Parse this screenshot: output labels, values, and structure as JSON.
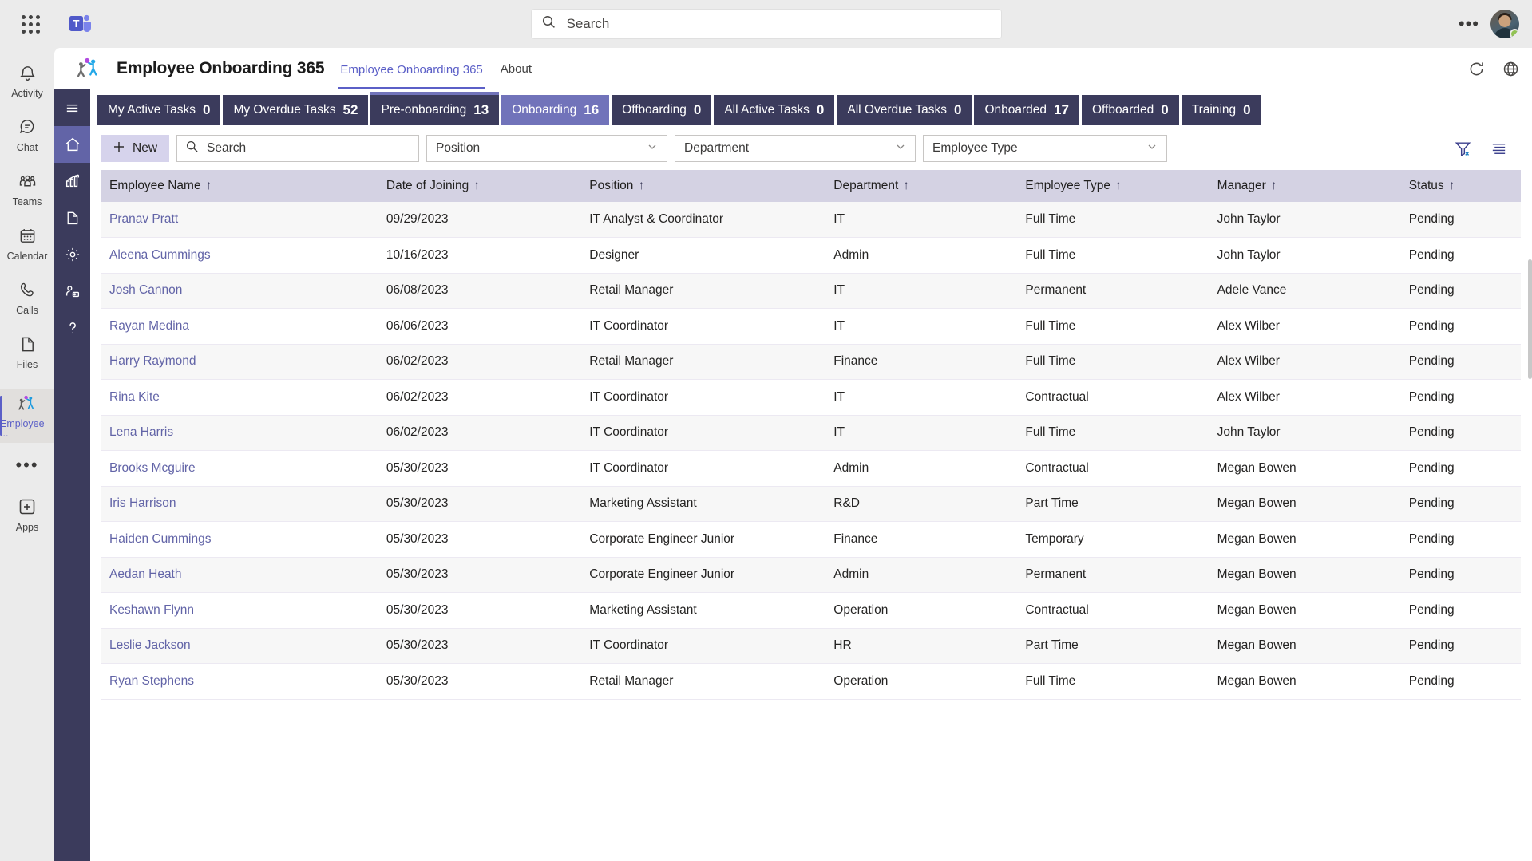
{
  "topbar": {
    "waffle_icon": "app-launcher-icon",
    "teams_logo": "microsoft-teams-logo",
    "search_placeholder": "Search",
    "search_value": "",
    "more_label": "•••"
  },
  "rail": {
    "items": [
      {
        "label": "Activity",
        "icon": "bell-icon",
        "active": false
      },
      {
        "label": "Chat",
        "icon": "chat-bubble-icon",
        "active": false
      },
      {
        "label": "Teams",
        "icon": "people-icon",
        "active": false
      },
      {
        "label": "Calendar",
        "icon": "calendar-icon",
        "active": false
      },
      {
        "label": "Calls",
        "icon": "phone-icon",
        "active": false
      },
      {
        "label": "Files",
        "icon": "document-icon",
        "active": false
      },
      {
        "label": "Employee ...",
        "icon": "employee-onboarding-icon",
        "active": true
      }
    ],
    "more_label": "•••",
    "apps_label": "Apps",
    "apps_icon": "apps-plus-icon"
  },
  "app_header": {
    "icon": "employee-onboarding-icon",
    "title": "Employee Onboarding 365",
    "tabs": [
      {
        "label": "Employee Onboarding 365",
        "selected": true
      },
      {
        "label": "About",
        "selected": false
      }
    ],
    "refresh_icon": "refresh-icon",
    "globe_icon": "globe-icon"
  },
  "innernav": {
    "items": [
      {
        "icon": "hamburger-menu-icon",
        "name": "menu-toggle",
        "active": false
      },
      {
        "icon": "home-icon",
        "name": "nav-home",
        "active": true
      },
      {
        "icon": "chart-icon",
        "name": "nav-reports",
        "active": false
      },
      {
        "icon": "document-icon",
        "name": "nav-documents",
        "active": false
      },
      {
        "icon": "gear-icon",
        "name": "nav-settings",
        "active": false
      },
      {
        "icon": "user-settings-icon",
        "name": "nav-users",
        "active": false
      },
      {
        "icon": "question-icon",
        "name": "nav-help",
        "active": false
      }
    ]
  },
  "tabstrip": {
    "tabs": [
      {
        "label": "My Active Tasks",
        "count": "0",
        "active": false
      },
      {
        "label": "My Overdue Tasks",
        "count": "52",
        "active": false
      },
      {
        "label": "Pre-onboarding",
        "count": "13",
        "active": false
      },
      {
        "label": "Onboarding",
        "count": "16",
        "active": true
      },
      {
        "label": "Offboarding",
        "count": "0",
        "active": false
      },
      {
        "label": "All Active Tasks",
        "count": "0",
        "active": false
      },
      {
        "label": "All Overdue Tasks",
        "count": "0",
        "active": false
      },
      {
        "label": "Onboarded",
        "count": "17",
        "active": false
      },
      {
        "label": "Offboarded",
        "count": "0",
        "active": false
      },
      {
        "label": "Training",
        "count": "0",
        "active": false
      }
    ]
  },
  "toolbar": {
    "new_label": "New",
    "new_icon": "plus-icon",
    "search_placeholder": "Search",
    "search_value": "",
    "search_icon": "search-icon",
    "filters": [
      {
        "name": "position-filter",
        "value": "Position"
      },
      {
        "name": "department-filter",
        "value": "Department"
      },
      {
        "name": "employee-type-filter",
        "value": "Employee Type"
      }
    ],
    "clear_filter_icon": "clear-filter-icon",
    "list-options_icon": "list-options-icon"
  },
  "table": {
    "sort_indicator": "↑",
    "columns": [
      "Employee Name",
      "Date of Joining",
      "Position",
      "Department",
      "Employee Type",
      "Manager",
      "Status"
    ],
    "rows": [
      {
        "name": "Pranav Pratt",
        "date": "09/29/2023",
        "position": "IT Analyst & Coordinator",
        "department": "IT",
        "type": "Full Time",
        "manager": "John Taylor",
        "status": "Pending"
      },
      {
        "name": "Aleena Cummings",
        "date": "10/16/2023",
        "position": "Designer",
        "department": "Admin",
        "type": "Full Time",
        "manager": "John Taylor",
        "status": "Pending"
      },
      {
        "name": "Josh Cannon",
        "date": "06/08/2023",
        "position": "Retail Manager",
        "department": "IT",
        "type": "Permanent",
        "manager": "Adele Vance",
        "status": "Pending"
      },
      {
        "name": "Rayan Medina",
        "date": "06/06/2023",
        "position": "IT Coordinator",
        "department": "IT",
        "type": "Full Time",
        "manager": "Alex Wilber",
        "status": "Pending"
      },
      {
        "name": "Harry Raymond",
        "date": "06/02/2023",
        "position": "Retail Manager",
        "department": "Finance",
        "type": "Full Time",
        "manager": "Alex Wilber",
        "status": "Pending"
      },
      {
        "name": "Rina Kite",
        "date": "06/02/2023",
        "position": "IT Coordinator",
        "department": "IT",
        "type": "Contractual",
        "manager": "Alex Wilber",
        "status": "Pending"
      },
      {
        "name": "Lena Harris",
        "date": "06/02/2023",
        "position": "IT Coordinator",
        "department": "IT",
        "type": "Full Time",
        "manager": "John Taylor",
        "status": "Pending"
      },
      {
        "name": "Brooks Mcguire",
        "date": "05/30/2023",
        "position": "IT Coordinator",
        "department": "Admin",
        "type": "Contractual",
        "manager": "Megan Bowen",
        "status": "Pending"
      },
      {
        "name": "Iris Harrison",
        "date": "05/30/2023",
        "position": "Marketing Assistant",
        "department": "R&D",
        "type": "Part Time",
        "manager": "Megan Bowen",
        "status": "Pending"
      },
      {
        "name": "Haiden Cummings",
        "date": "05/30/2023",
        "position": "Corporate Engineer Junior",
        "department": "Finance",
        "type": "Temporary",
        "manager": "Megan Bowen",
        "status": "Pending"
      },
      {
        "name": "Aedan Heath",
        "date": "05/30/2023",
        "position": "Corporate Engineer Junior",
        "department": "Admin",
        "type": "Permanent",
        "manager": "Megan Bowen",
        "status": "Pending"
      },
      {
        "name": "Keshawn Flynn",
        "date": "05/30/2023",
        "position": "Marketing Assistant",
        "department": "Operation",
        "type": "Contractual",
        "manager": "Megan Bowen",
        "status": "Pending"
      },
      {
        "name": "Leslie Jackson",
        "date": "05/30/2023",
        "position": "IT Coordinator",
        "department": "HR",
        "type": "Part Time",
        "manager": "Megan Bowen",
        "status": "Pending"
      },
      {
        "name": "Ryan Stephens",
        "date": "05/30/2023",
        "position": "Retail Manager",
        "department": "Operation",
        "type": "Full Time",
        "manager": "Megan Bowen",
        "status": "Pending"
      }
    ]
  },
  "colors": {
    "teams_purple": "#6264a7",
    "nav_dark": "#3b3b5c",
    "tab_active": "#7173ba",
    "header_row": "#d4d2e3",
    "link": "#6264a7"
  }
}
